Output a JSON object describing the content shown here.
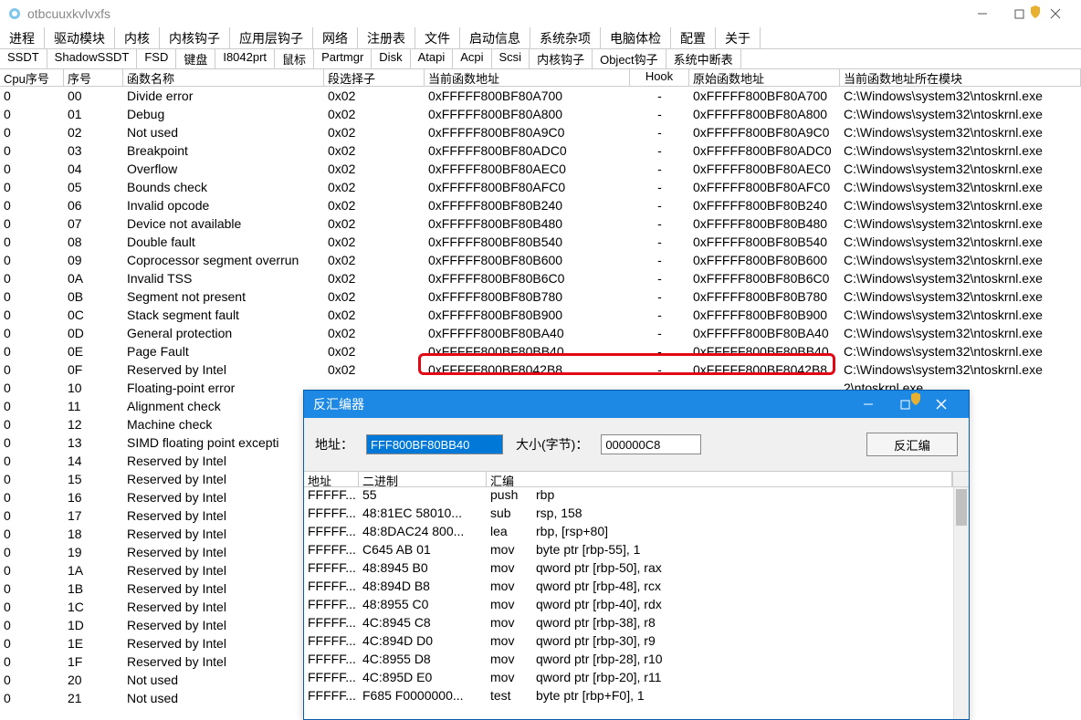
{
  "window": {
    "title": "otbcuuxkvlvxfs"
  },
  "top_tabs": [
    "进程",
    "驱动模块",
    "内核",
    "内核钩子",
    "应用层钩子",
    "网络",
    "注册表",
    "文件",
    "启动信息",
    "系统杂项",
    "电脑体检",
    "配置",
    "关于"
  ],
  "sub_tabs": [
    "SSDT",
    "ShadowSSDT",
    "FSD",
    "键盘",
    "I8042prt",
    "鼠标",
    "Partmgr",
    "Disk",
    "Atapi",
    "Acpi",
    "Scsi",
    "内核钩子",
    "Object钩子",
    "系统中断表"
  ],
  "columns": [
    "Cpu序号",
    "序号",
    "函数名称",
    "段选择子",
    "当前函数地址",
    "Hook",
    "原始函数地址",
    "当前函数地址所在模块"
  ],
  "module_path": "C:\\Windows\\system32\\ntoskrnl.exe",
  "module_short": "2\\ntoskrnl.exe",
  "rows": [
    {
      "cpu": "0",
      "idx": "00",
      "name": "Divide error",
      "seg": "0x02",
      "cur": "0xFFFFF800BF80A700",
      "hook": "-",
      "orig": "0xFFFFF800BF80A700",
      "m": "full"
    },
    {
      "cpu": "0",
      "idx": "01",
      "name": "Debug",
      "seg": "0x02",
      "cur": "0xFFFFF800BF80A800",
      "hook": "-",
      "orig": "0xFFFFF800BF80A800",
      "m": "full"
    },
    {
      "cpu": "0",
      "idx": "02",
      "name": "Not used",
      "seg": "0x02",
      "cur": "0xFFFFF800BF80A9C0",
      "hook": "-",
      "orig": "0xFFFFF800BF80A9C0",
      "m": "full"
    },
    {
      "cpu": "0",
      "idx": "03",
      "name": "Breakpoint",
      "seg": "0x02",
      "cur": "0xFFFFF800BF80ADC0",
      "hook": "-",
      "orig": "0xFFFFF800BF80ADC0",
      "m": "full"
    },
    {
      "cpu": "0",
      "idx": "04",
      "name": "Overflow",
      "seg": "0x02",
      "cur": "0xFFFFF800BF80AEC0",
      "hook": "-",
      "orig": "0xFFFFF800BF80AEC0",
      "m": "full"
    },
    {
      "cpu": "0",
      "idx": "05",
      "name": "Bounds check",
      "seg": "0x02",
      "cur": "0xFFFFF800BF80AFC0",
      "hook": "-",
      "orig": "0xFFFFF800BF80AFC0",
      "m": "full"
    },
    {
      "cpu": "0",
      "idx": "06",
      "name": "Invalid opcode",
      "seg": "0x02",
      "cur": "0xFFFFF800BF80B240",
      "hook": "-",
      "orig": "0xFFFFF800BF80B240",
      "m": "full"
    },
    {
      "cpu": "0",
      "idx": "07",
      "name": "Device not available",
      "seg": "0x02",
      "cur": "0xFFFFF800BF80B480",
      "hook": "-",
      "orig": "0xFFFFF800BF80B480",
      "m": "full"
    },
    {
      "cpu": "0",
      "idx": "08",
      "name": "Double fault",
      "seg": "0x02",
      "cur": "0xFFFFF800BF80B540",
      "hook": "-",
      "orig": "0xFFFFF800BF80B540",
      "m": "full"
    },
    {
      "cpu": "0",
      "idx": "09",
      "name": "Coprocessor segment overrun",
      "seg": "0x02",
      "cur": "0xFFFFF800BF80B600",
      "hook": "-",
      "orig": "0xFFFFF800BF80B600",
      "m": "full"
    },
    {
      "cpu": "0",
      "idx": "0A",
      "name": "Invalid TSS",
      "seg": "0x02",
      "cur": "0xFFFFF800BF80B6C0",
      "hook": "-",
      "orig": "0xFFFFF800BF80B6C0",
      "m": "full"
    },
    {
      "cpu": "0",
      "idx": "0B",
      "name": "Segment not present",
      "seg": "0x02",
      "cur": "0xFFFFF800BF80B780",
      "hook": "-",
      "orig": "0xFFFFF800BF80B780",
      "m": "full"
    },
    {
      "cpu": "0",
      "idx": "0C",
      "name": "Stack segment fault",
      "seg": "0x02",
      "cur": "0xFFFFF800BF80B900",
      "hook": "-",
      "orig": "0xFFFFF800BF80B900",
      "m": "full"
    },
    {
      "cpu": "0",
      "idx": "0D",
      "name": "General protection",
      "seg": "0x02",
      "cur": "0xFFFFF800BF80BA40",
      "hook": "-",
      "orig": "0xFFFFF800BF80BA40",
      "m": "full"
    },
    {
      "cpu": "0",
      "idx": "0E",
      "name": "Page Fault",
      "seg": "0x02",
      "cur": "0xFFFFF800BF80BB40",
      "hook": "-",
      "orig": "0xFFFFF800BF80BB40",
      "m": "full"
    },
    {
      "cpu": "0",
      "idx": "0F",
      "name": "Reserved by Intel",
      "seg": "0x02",
      "cur": "0xFFFFF800BF8042B8",
      "hook": "-",
      "orig": "0xFFFFF800BF8042B8",
      "m": "full"
    },
    {
      "cpu": "0",
      "idx": "10",
      "name": "Floating-point error",
      "seg": "",
      "cur": "",
      "hook": "",
      "orig": "",
      "m": "short"
    },
    {
      "cpu": "0",
      "idx": "11",
      "name": "Alignment check",
      "seg": "",
      "cur": "",
      "hook": "",
      "orig": "",
      "m": "short"
    },
    {
      "cpu": "0",
      "idx": "12",
      "name": "Machine check",
      "seg": "",
      "cur": "",
      "hook": "",
      "orig": "",
      "m": "short"
    },
    {
      "cpu": "0",
      "idx": "13",
      "name": "SIMD floating point excepti",
      "seg": "",
      "cur": "",
      "hook": "",
      "orig": "",
      "m": "short"
    },
    {
      "cpu": "0",
      "idx": "14",
      "name": "Reserved by Intel",
      "seg": "",
      "cur": "",
      "hook": "",
      "orig": "",
      "m": "short"
    },
    {
      "cpu": "0",
      "idx": "15",
      "name": "Reserved by Intel",
      "seg": "",
      "cur": "",
      "hook": "",
      "orig": "",
      "m": "short"
    },
    {
      "cpu": "0",
      "idx": "16",
      "name": "Reserved by Intel",
      "seg": "",
      "cur": "",
      "hook": "",
      "orig": "",
      "m": "short"
    },
    {
      "cpu": "0",
      "idx": "17",
      "name": "Reserved by Intel",
      "seg": "",
      "cur": "",
      "hook": "",
      "orig": "",
      "m": "short"
    },
    {
      "cpu": "0",
      "idx": "18",
      "name": "Reserved by Intel",
      "seg": "",
      "cur": "",
      "hook": "",
      "orig": "",
      "m": "short"
    },
    {
      "cpu": "0",
      "idx": "19",
      "name": "Reserved by Intel",
      "seg": "",
      "cur": "",
      "hook": "",
      "orig": "",
      "m": "short"
    },
    {
      "cpu": "0",
      "idx": "1A",
      "name": "Reserved by Intel",
      "seg": "",
      "cur": "",
      "hook": "",
      "orig": "",
      "m": "short"
    },
    {
      "cpu": "0",
      "idx": "1B",
      "name": "Reserved by Intel",
      "seg": "",
      "cur": "",
      "hook": "",
      "orig": "",
      "m": "short"
    },
    {
      "cpu": "0",
      "idx": "1C",
      "name": "Reserved by Intel",
      "seg": "",
      "cur": "",
      "hook": "",
      "orig": "",
      "m": "short"
    },
    {
      "cpu": "0",
      "idx": "1D",
      "name": "Reserved by Intel",
      "seg": "",
      "cur": "",
      "hook": "",
      "orig": "",
      "m": "short"
    },
    {
      "cpu": "0",
      "idx": "1E",
      "name": "Reserved by Intel",
      "seg": "",
      "cur": "",
      "hook": "",
      "orig": "",
      "m": "short"
    },
    {
      "cpu": "0",
      "idx": "1F",
      "name": "Reserved by Intel",
      "seg": "",
      "cur": "",
      "hook": "",
      "orig": "",
      "m": "short"
    },
    {
      "cpu": "0",
      "idx": "20",
      "name": "Not used",
      "seg": "",
      "cur": "",
      "hook": "",
      "orig": "",
      "m": "short"
    },
    {
      "cpu": "0",
      "idx": "21",
      "name": "Not used",
      "seg": "",
      "cur": "",
      "hook": "",
      "orig": "",
      "m": "short"
    }
  ],
  "dialog": {
    "title": "反汇编器",
    "addr_label": "地址：",
    "addr_value": "FFF800BF80BB40",
    "size_label": "大小(字节)：",
    "size_value": "000000C8",
    "button": "反汇编",
    "columns": [
      "地址",
      "二进制",
      "汇编"
    ],
    "rows": [
      {
        "a": "FFFFF...",
        "b": "55",
        "op": "push",
        "arg": "rbp"
      },
      {
        "a": "FFFFF...",
        "b": "48:81EC 58010...",
        "op": "sub",
        "arg": "rsp, 158"
      },
      {
        "a": "FFFFF...",
        "b": "48:8DAC24 800...",
        "op": "lea",
        "arg": "rbp, [rsp+80]"
      },
      {
        "a": "FFFFF...",
        "b": "C645 AB 01",
        "op": "mov",
        "arg": "byte ptr [rbp-55], 1"
      },
      {
        "a": "FFFFF...",
        "b": "48:8945 B0",
        "op": "mov",
        "arg": "qword ptr [rbp-50], rax"
      },
      {
        "a": "FFFFF...",
        "b": "48:894D B8",
        "op": "mov",
        "arg": "qword ptr [rbp-48], rcx"
      },
      {
        "a": "FFFFF...",
        "b": "48:8955 C0",
        "op": "mov",
        "arg": "qword ptr [rbp-40], rdx"
      },
      {
        "a": "FFFFF...",
        "b": "4C:8945 C8",
        "op": "mov",
        "arg": "qword ptr [rbp-38], r8"
      },
      {
        "a": "FFFFF...",
        "b": "4C:894D D0",
        "op": "mov",
        "arg": "qword ptr [rbp-30], r9"
      },
      {
        "a": "FFFFF...",
        "b": "4C:8955 D8",
        "op": "mov",
        "arg": "qword ptr [rbp-28], r10"
      },
      {
        "a": "FFFFF...",
        "b": "4C:895D E0",
        "op": "mov",
        "arg": "qword ptr [rbp-20], r11"
      },
      {
        "a": "FFFFF...",
        "b": "F685 F0000000...",
        "op": "test",
        "arg": "byte ptr [rbp+F0], 1"
      }
    ]
  }
}
